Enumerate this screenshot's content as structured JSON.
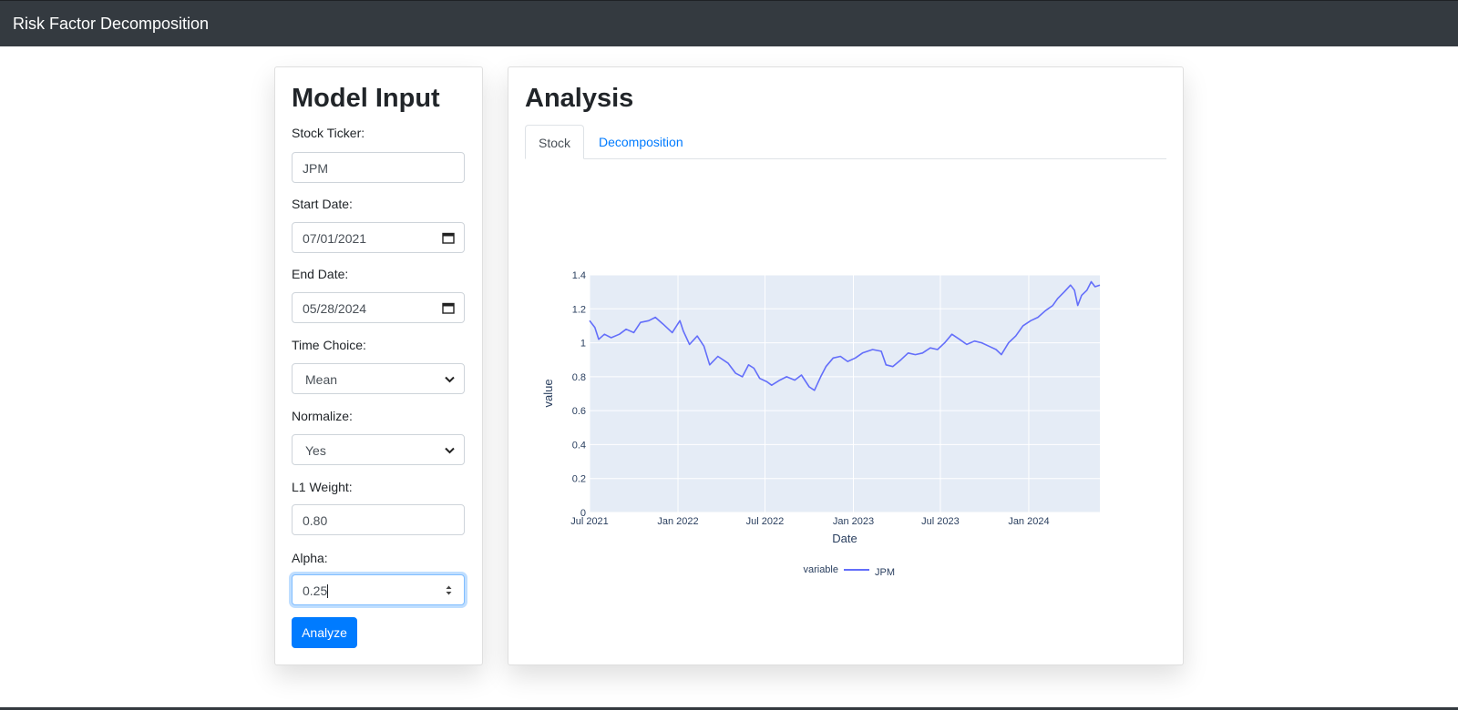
{
  "app": {
    "title": "Risk Factor Decomposition"
  },
  "model_input": {
    "title": "Model Input",
    "ticker": {
      "label": "Stock Ticker:",
      "value": "JPM"
    },
    "start_date": {
      "label": "Start Date:",
      "value": "07/01/2021"
    },
    "end_date": {
      "label": "End Date:",
      "value": "05/28/2024"
    },
    "time_choice": {
      "label": "Time Choice:",
      "value": "Mean"
    },
    "normalize": {
      "label": "Normalize:",
      "value": "Yes"
    },
    "l1_weight": {
      "label": "L1 Weight:",
      "value": "0.80"
    },
    "alpha": {
      "label": "Alpha:",
      "value": "0.25"
    },
    "analyze_label": "Analyze"
  },
  "analysis": {
    "title": "Analysis",
    "tabs": [
      {
        "label": "Stock",
        "active": true
      },
      {
        "label": "Decomposition",
        "active": false
      }
    ]
  },
  "colors": {
    "navbar": "#343a40",
    "accent": "#007bff",
    "plot_bg": "#e5ecf6",
    "series": "#636efa"
  },
  "icons": {
    "date": "calendar-icon",
    "select": "chevron-down-icon",
    "number": "spinner-arrows-icon"
  },
  "chart_data": {
    "type": "line",
    "xlabel": "Date",
    "ylabel": "value",
    "ylim": [
      0,
      1.4
    ],
    "yticks": [
      0,
      0.2,
      0.4,
      0.6,
      0.8,
      1,
      1.2,
      1.4
    ],
    "ytick_labels": [
      "0",
      "0.2",
      "0.4",
      "0.6",
      "0.8",
      "1",
      "1.2",
      "1.4"
    ],
    "xticks": [
      {
        "label": "Jul 2021",
        "date": "2021-07-01"
      },
      {
        "label": "Jan 2022",
        "date": "2022-01-01"
      },
      {
        "label": "Jul 2022",
        "date": "2022-07-01"
      },
      {
        "label": "Jan 2023",
        "date": "2023-01-01"
      },
      {
        "label": "Jul 2023",
        "date": "2023-07-01"
      },
      {
        "label": "Jan 2024",
        "date": "2024-01-01"
      }
    ],
    "xrange": [
      "2021-07-01",
      "2024-05-28"
    ],
    "legend_title": "variable",
    "legend_position": "bottom-center",
    "grid": true,
    "series": [
      {
        "name": "JPM",
        "color": "#636efa",
        "points": [
          [
            "2021-07-01",
            1.13
          ],
          [
            "2021-07-12",
            1.09
          ],
          [
            "2021-07-20",
            1.02
          ],
          [
            "2021-08-01",
            1.05
          ],
          [
            "2021-08-15",
            1.03
          ],
          [
            "2021-09-01",
            1.05
          ],
          [
            "2021-09-15",
            1.08
          ],
          [
            "2021-10-01",
            1.06
          ],
          [
            "2021-10-15",
            1.12
          ],
          [
            "2021-11-01",
            1.13
          ],
          [
            "2021-11-15",
            1.15
          ],
          [
            "2021-12-01",
            1.11
          ],
          [
            "2021-12-20",
            1.06
          ],
          [
            "2022-01-05",
            1.13
          ],
          [
            "2022-01-12",
            1.07
          ],
          [
            "2022-01-25",
            0.99
          ],
          [
            "2022-02-10",
            1.04
          ],
          [
            "2022-02-24",
            0.98
          ],
          [
            "2022-03-08",
            0.87
          ],
          [
            "2022-03-25",
            0.92
          ],
          [
            "2022-04-15",
            0.88
          ],
          [
            "2022-05-01",
            0.82
          ],
          [
            "2022-05-15",
            0.8
          ],
          [
            "2022-05-28",
            0.87
          ],
          [
            "2022-06-08",
            0.85
          ],
          [
            "2022-06-20",
            0.79
          ],
          [
            "2022-07-05",
            0.77
          ],
          [
            "2022-07-15",
            0.75
          ],
          [
            "2022-08-01",
            0.78
          ],
          [
            "2022-08-15",
            0.8
          ],
          [
            "2022-09-01",
            0.78
          ],
          [
            "2022-09-15",
            0.81
          ],
          [
            "2022-10-01",
            0.74
          ],
          [
            "2022-10-12",
            0.72
          ],
          [
            "2022-10-25",
            0.8
          ],
          [
            "2022-11-05",
            0.86
          ],
          [
            "2022-11-20",
            0.91
          ],
          [
            "2022-12-05",
            0.92
          ],
          [
            "2022-12-20",
            0.89
          ],
          [
            "2023-01-05",
            0.91
          ],
          [
            "2023-01-20",
            0.94
          ],
          [
            "2023-02-10",
            0.96
          ],
          [
            "2023-02-28",
            0.95
          ],
          [
            "2023-03-10",
            0.87
          ],
          [
            "2023-03-24",
            0.86
          ],
          [
            "2023-04-10",
            0.9
          ],
          [
            "2023-04-25",
            0.94
          ],
          [
            "2023-05-10",
            0.93
          ],
          [
            "2023-05-25",
            0.94
          ],
          [
            "2023-06-10",
            0.97
          ],
          [
            "2023-06-25",
            0.96
          ],
          [
            "2023-07-10",
            1.0
          ],
          [
            "2023-07-25",
            1.05
          ],
          [
            "2023-08-10",
            1.02
          ],
          [
            "2023-08-25",
            0.99
          ],
          [
            "2023-09-10",
            1.01
          ],
          [
            "2023-09-25",
            1.0
          ],
          [
            "2023-10-10",
            0.98
          ],
          [
            "2023-10-25",
            0.96
          ],
          [
            "2023-11-05",
            0.93
          ],
          [
            "2023-11-20",
            1.0
          ],
          [
            "2023-12-05",
            1.04
          ],
          [
            "2023-12-20",
            1.1
          ],
          [
            "2024-01-05",
            1.13
          ],
          [
            "2024-01-20",
            1.15
          ],
          [
            "2024-02-05",
            1.19
          ],
          [
            "2024-02-20",
            1.22
          ],
          [
            "2024-03-01",
            1.26
          ],
          [
            "2024-03-15",
            1.3
          ],
          [
            "2024-03-28",
            1.34
          ],
          [
            "2024-04-05",
            1.31
          ],
          [
            "2024-04-12",
            1.22
          ],
          [
            "2024-04-20",
            1.28
          ],
          [
            "2024-05-01",
            1.31
          ],
          [
            "2024-05-10",
            1.36
          ],
          [
            "2024-05-18",
            1.33
          ],
          [
            "2024-05-28",
            1.34
          ]
        ]
      }
    ]
  }
}
